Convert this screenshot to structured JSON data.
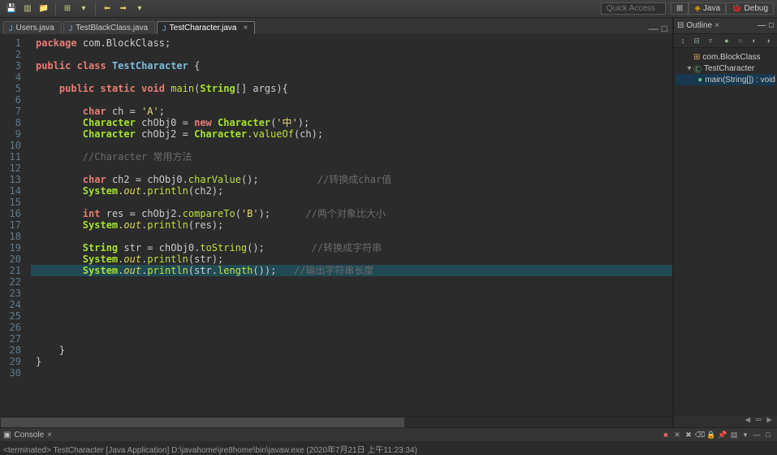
{
  "toolbar": {
    "quick_access_placeholder": "Quick Access",
    "persp_java": "Java",
    "persp_debug": "Debug"
  },
  "tabs": [
    {
      "label": "Users.java",
      "active": false
    },
    {
      "label": "TestBlackClass.java",
      "active": false
    },
    {
      "label": "TestCharacter.java",
      "active": true
    }
  ],
  "code": {
    "highlight_line": 21,
    "lines": [
      [
        [
          "kw",
          "package"
        ],
        [
          "pun",
          " "
        ],
        [
          "id",
          "com.BlockClass"
        ],
        [
          "pun",
          ";"
        ]
      ],
      [],
      [
        [
          "kw",
          "public"
        ],
        [
          "pun",
          " "
        ],
        [
          "kw",
          "class"
        ],
        [
          "pun",
          " "
        ],
        [
          "cname",
          "TestCharacter"
        ],
        [
          "pun",
          " {"
        ]
      ],
      [],
      [
        [
          "pun",
          "    "
        ],
        [
          "kw",
          "public"
        ],
        [
          "pun",
          " "
        ],
        [
          "kw",
          "static"
        ],
        [
          "pun",
          " "
        ],
        [
          "kw",
          "void"
        ],
        [
          "pun",
          " "
        ],
        [
          "fn",
          "main"
        ],
        [
          "pun",
          "("
        ],
        [
          "type",
          "String"
        ],
        [
          "pun",
          "[] "
        ],
        [
          "id",
          "args"
        ],
        [
          "pun",
          "){"
        ]
      ],
      [],
      [
        [
          "pun",
          "        "
        ],
        [
          "kw",
          "char"
        ],
        [
          "pun",
          " "
        ],
        [
          "id",
          "ch"
        ],
        [
          "pun",
          " = "
        ],
        [
          "str",
          "'A'"
        ],
        [
          "pun",
          ";"
        ]
      ],
      [
        [
          "pun",
          "        "
        ],
        [
          "type",
          "Character"
        ],
        [
          "pun",
          " "
        ],
        [
          "id",
          "chObj0"
        ],
        [
          "pun",
          " = "
        ],
        [
          "kw",
          "new"
        ],
        [
          "pun",
          " "
        ],
        [
          "type",
          "Character"
        ],
        [
          "pun",
          "("
        ],
        [
          "str",
          "'中'"
        ],
        [
          "pun",
          ");"
        ]
      ],
      [
        [
          "pun",
          "        "
        ],
        [
          "type",
          "Character"
        ],
        [
          "pun",
          " "
        ],
        [
          "id",
          "chObj2"
        ],
        [
          "pun",
          " = "
        ],
        [
          "type",
          "Character"
        ],
        [
          "pun",
          "."
        ],
        [
          "fn",
          "valueOf"
        ],
        [
          "pun",
          "("
        ],
        [
          "id",
          "ch"
        ],
        [
          "pun",
          ");"
        ]
      ],
      [],
      [
        [
          "pun",
          "        "
        ],
        [
          "cmt",
          "//Character 常用方法"
        ]
      ],
      [],
      [
        [
          "pun",
          "        "
        ],
        [
          "kw",
          "char"
        ],
        [
          "pun",
          " "
        ],
        [
          "id",
          "ch2"
        ],
        [
          "pun",
          " = "
        ],
        [
          "id",
          "chObj0"
        ],
        [
          "pun",
          "."
        ],
        [
          "fn",
          "charValue"
        ],
        [
          "pun",
          "();          "
        ],
        [
          "cmt",
          "//转换成char值"
        ]
      ],
      [
        [
          "pun",
          "        "
        ],
        [
          "type",
          "System"
        ],
        [
          "pun",
          "."
        ],
        [
          "out",
          "out"
        ],
        [
          "pun",
          "."
        ],
        [
          "fn",
          "println"
        ],
        [
          "pun",
          "("
        ],
        [
          "id",
          "ch2"
        ],
        [
          "pun",
          ");"
        ]
      ],
      [],
      [
        [
          "pun",
          "        "
        ],
        [
          "kw",
          "int"
        ],
        [
          "pun",
          " "
        ],
        [
          "id",
          "res"
        ],
        [
          "pun",
          " = "
        ],
        [
          "id",
          "chObj2"
        ],
        [
          "pun",
          "."
        ],
        [
          "fn",
          "compareTo"
        ],
        [
          "pun",
          "("
        ],
        [
          "str",
          "'B'"
        ],
        [
          "pun",
          ");      "
        ],
        [
          "cmt",
          "//两个对象比大小"
        ]
      ],
      [
        [
          "pun",
          "        "
        ],
        [
          "type",
          "System"
        ],
        [
          "pun",
          "."
        ],
        [
          "out",
          "out"
        ],
        [
          "pun",
          "."
        ],
        [
          "fn",
          "println"
        ],
        [
          "pun",
          "("
        ],
        [
          "id",
          "res"
        ],
        [
          "pun",
          ");"
        ]
      ],
      [],
      [
        [
          "pun",
          "        "
        ],
        [
          "type",
          "String"
        ],
        [
          "pun",
          " "
        ],
        [
          "id",
          "str"
        ],
        [
          "pun",
          " = "
        ],
        [
          "id",
          "chObj0"
        ],
        [
          "pun",
          "."
        ],
        [
          "fn",
          "toString"
        ],
        [
          "pun",
          "();        "
        ],
        [
          "cmt",
          "//转换成字符串"
        ]
      ],
      [
        [
          "pun",
          "        "
        ],
        [
          "type",
          "System"
        ],
        [
          "pun",
          "."
        ],
        [
          "out",
          "out"
        ],
        [
          "pun",
          "."
        ],
        [
          "fn",
          "println"
        ],
        [
          "pun",
          "("
        ],
        [
          "id",
          "str"
        ],
        [
          "pun",
          ");"
        ]
      ],
      [
        [
          "pun",
          "        "
        ],
        [
          "type",
          "System"
        ],
        [
          "pun",
          "."
        ],
        [
          "out",
          "out"
        ],
        [
          "pun",
          "."
        ],
        [
          "fn",
          "println"
        ],
        [
          "pun",
          "("
        ],
        [
          "id",
          "str"
        ],
        [
          "pun",
          "."
        ],
        [
          "fn",
          "length"
        ],
        [
          "pun",
          "());   "
        ],
        [
          "cmt",
          "//输出字符串长度"
        ]
      ],
      [],
      [],
      [],
      [],
      [],
      [],
      [
        [
          "pun",
          "    }"
        ]
      ],
      [
        [
          "pun",
          "}"
        ]
      ],
      []
    ]
  },
  "outline": {
    "title": "Outline",
    "package": "com.BlockClass",
    "class": "TestCharacter",
    "method": "main(String[]) : void"
  },
  "console": {
    "title": "Console",
    "body": "<terminated> TestCharacter [Java Application] D:\\javahome\\jre8home\\bin\\javaw.exe (2020年7月21日 上午11:23:34)"
  }
}
